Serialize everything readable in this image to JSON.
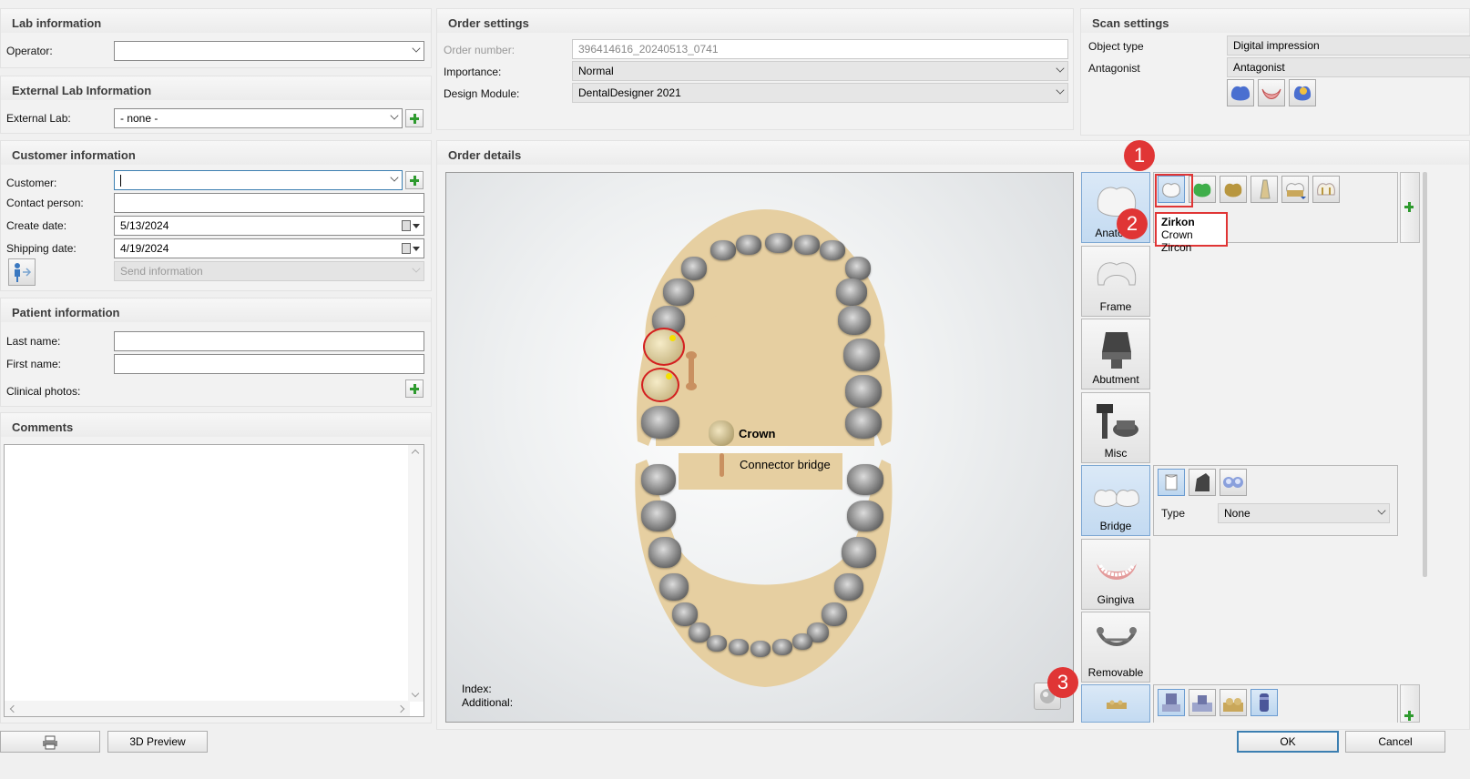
{
  "lab_info": {
    "title": "Lab information",
    "operator_label": "Operator:",
    "operator_value": ""
  },
  "external_lab": {
    "title": "External Lab Information",
    "label": "External Lab:",
    "value": "- none -"
  },
  "customer_info": {
    "title": "Customer information",
    "customer_label": "Customer:",
    "customer_value": "",
    "contact_label": "Contact person:",
    "contact_value": "",
    "create_label": "Create date:",
    "create_value": "5/13/2024",
    "shipping_label": "Shipping date:",
    "shipping_value": "4/19/2024",
    "send_info": "Send information"
  },
  "patient_info": {
    "title": "Patient information",
    "last_label": "Last name:",
    "first_label": "First name:",
    "photos_label": "Clinical photos:"
  },
  "comments": {
    "title": "Comments"
  },
  "order_settings": {
    "title": "Order settings",
    "order_number_label": "Order number:",
    "order_number_value": "396414616_20240513_0741",
    "importance_label": "Importance:",
    "importance_value": "Normal",
    "design_module_label": "Design Module:",
    "design_module_value": "DentalDesigner 2021"
  },
  "scan_settings": {
    "title": "Scan settings",
    "object_type_label": "Object type",
    "object_type_value": "Digital impression",
    "antagonist_label": "Antagonist",
    "antagonist_value": "Antagonist"
  },
  "order_details": {
    "title": "Order details",
    "legend_crown": "Crown",
    "legend_connector": "Connector bridge",
    "index_label": "Index:",
    "additional_label": "Additional:"
  },
  "tools": [
    {
      "label": "Anatomy"
    },
    {
      "label": "Frame"
    },
    {
      "label": "Abutment"
    },
    {
      "label": "Misc"
    },
    {
      "label": "Bridge"
    },
    {
      "label": "Gingiva"
    },
    {
      "label": "Removable"
    }
  ],
  "anatomy_tooltip": {
    "title": "Zirkon",
    "subtitle": "Crown Zircon"
  },
  "bridge_panel": {
    "type_label": "Type",
    "type_value": "None"
  },
  "callouts": [
    "1",
    "2",
    "3"
  ],
  "footer": {
    "preview_label": "3D Preview",
    "ok_label": "OK",
    "cancel_label": "Cancel"
  },
  "colors": {
    "accent_red": "#e03535",
    "selected_blue": "#c3daf1",
    "gum_beige": "#e6cfa1"
  }
}
